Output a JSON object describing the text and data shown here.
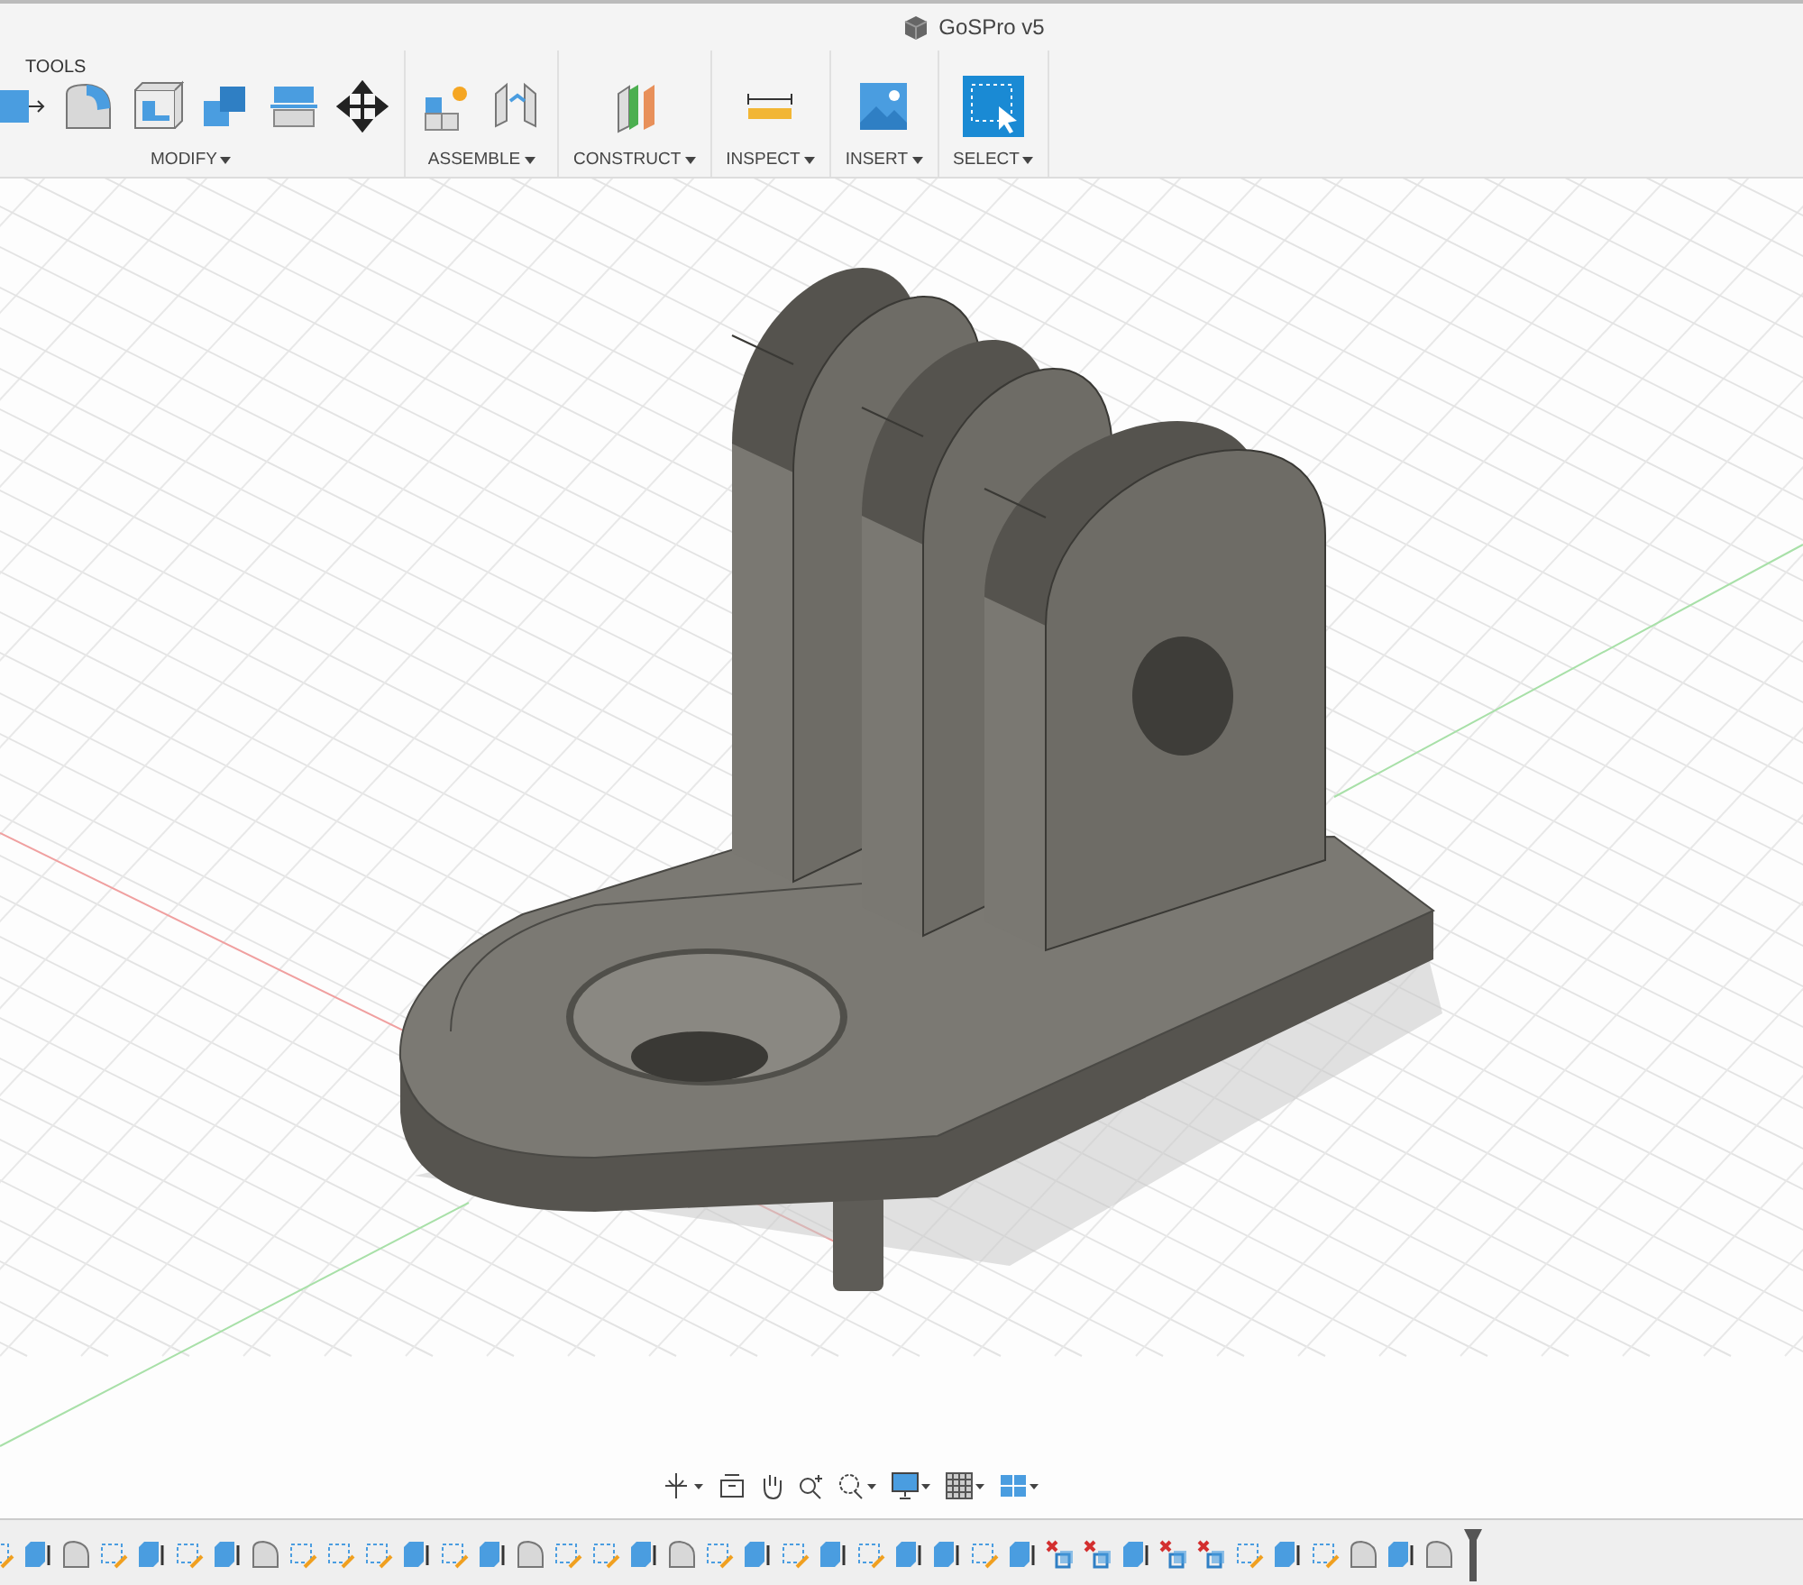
{
  "window": {
    "title": "GoSPro v5"
  },
  "toolbar": {
    "tab_label": "TOOLS",
    "groups": [
      {
        "kind": "modify",
        "label": "MODIFY"
      },
      {
        "kind": "assemble",
        "label": "ASSEMBLE"
      },
      {
        "kind": "construct",
        "label": "CONSTRUCT"
      },
      {
        "kind": "inspect",
        "label": "INSPECT"
      },
      {
        "kind": "insert",
        "label": "INSERT"
      },
      {
        "kind": "select",
        "label": "SELECT"
      }
    ]
  },
  "timeline": [
    {
      "kind": "sketch"
    },
    {
      "kind": "extrude"
    },
    {
      "kind": "fillet"
    },
    {
      "kind": "sketch"
    },
    {
      "kind": "extrude"
    },
    {
      "kind": "sketch"
    },
    {
      "kind": "extrude"
    },
    {
      "kind": "fillet"
    },
    {
      "kind": "sketch"
    },
    {
      "kind": "sketch"
    },
    {
      "kind": "sketch"
    },
    {
      "kind": "extrude"
    },
    {
      "kind": "sketch"
    },
    {
      "kind": "extrude"
    },
    {
      "kind": "fillet"
    },
    {
      "kind": "sketch"
    },
    {
      "kind": "sketch"
    },
    {
      "kind": "extrude"
    },
    {
      "kind": "fillet"
    },
    {
      "kind": "sketch"
    },
    {
      "kind": "extrude"
    },
    {
      "kind": "sketch"
    },
    {
      "kind": "extrude"
    },
    {
      "kind": "sketch"
    },
    {
      "kind": "extrude"
    },
    {
      "kind": "extrude"
    },
    {
      "kind": "sketch"
    },
    {
      "kind": "extrude"
    },
    {
      "kind": "joint"
    },
    {
      "kind": "joint"
    },
    {
      "kind": "extrude"
    },
    {
      "kind": "joint"
    },
    {
      "kind": "joint"
    },
    {
      "kind": "sketch"
    },
    {
      "kind": "extrude"
    },
    {
      "kind": "sketch"
    },
    {
      "kind": "fillet"
    },
    {
      "kind": "extrude"
    },
    {
      "kind": "fillet"
    }
  ]
}
